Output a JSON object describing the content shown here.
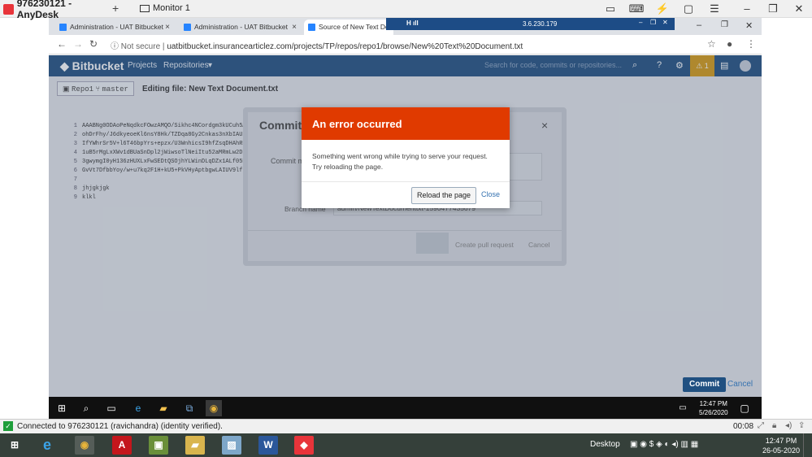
{
  "anydesk": {
    "title": "976230121 - AnyDesk",
    "new_tab": "+",
    "monitor_label": "Monitor 1",
    "toolbar_ip": "3.6.230.179"
  },
  "browser": {
    "tabs": [
      {
        "label": "Administration - UAT Bitbucket"
      },
      {
        "label": "Administration - UAT Bitbucket"
      },
      {
        "label": "Source of New Text Docum"
      }
    ],
    "security": "Not secure",
    "separator": "|",
    "url": "uatbitbucket.insurancearticlez.com/projects/TP/repos/repo1/browse/New%20Text%20Document.txt"
  },
  "bitbucket": {
    "logo": "Bitbucket",
    "nav": [
      "Projects",
      "Repositories"
    ],
    "search_placeholder": "Search for code, commits or repositories...",
    "warning_count": "1",
    "repo": "Repo1",
    "branch": "master",
    "editing_file": "Editing file: New Text Document.txt"
  },
  "code_lines": [
    {
      "n": "1",
      "text": "AAABNg0ODAoPeNqdkcFOwzAMQO/Sikhc4NCordgm3kUCuh5A7"
    },
    {
      "n": "2",
      "text": "ohDrFhy/J6dkyeoeKl6nsY8Hk/TZDqa8Gy2Cnkas3nXbIAU2w"
    },
    {
      "n": "3",
      "text": "IfYWhrSr5V+l6T46bpYrs+epzx/U3WnhicsI9hfZsqDHAhRPI"
    },
    {
      "n": "4",
      "text": "1uB5rMgLxXWv1dBUaSnDpl2jWiwsoTlNeiItu52aMRmLw2Ds1"
    },
    {
      "n": "5",
      "text": "3gwymgI0yH136zHUXLxFwSEDtQSOjhYLWinDLqDZx1ALf05DC"
    },
    {
      "n": "6",
      "text": "GvVt7DfbbYoy/w+u7kq2F1H+kU5+PkVHyAptbgwLAIUV9lfhb"
    },
    {
      "n": "7",
      "text": ""
    },
    {
      "n": "8",
      "text": "jhjgkjgk"
    },
    {
      "n": "9",
      "text": "klkl"
    }
  ],
  "commit_modal": {
    "title": "Commit t",
    "commit_label": "Commit m",
    "branch_label": "Branch name",
    "branch_value": "admin/NewTextDocumenttxt-1590477435679",
    "create_pr": "Create pull request",
    "cancel": "Cancel",
    "close": "×"
  },
  "error_dialog": {
    "title": "An error occurred",
    "message_line1": "Something went wrong while trying to serve your request.",
    "message_line2": "Try reloading the page.",
    "reload_button": "Reload the page",
    "close_link": "Close"
  },
  "editor_actions": {
    "commit": "Commit",
    "cancel": "Cancel"
  },
  "remote_taskbar": {
    "time": "12:47 PM",
    "date": "5/26/2020"
  },
  "status_bar": {
    "text": "Connected to 976230121 (ravichandra) (identity verified).",
    "elapsed": "00:08"
  },
  "local_taskbar": {
    "desktop_label": "Desktop",
    "time": "12:47 PM",
    "date": "26-05-2020"
  },
  "colors": {
    "bitbucket_blue": "#205081",
    "error_red": "#e03a00",
    "anydesk_red": "#e8343a"
  }
}
